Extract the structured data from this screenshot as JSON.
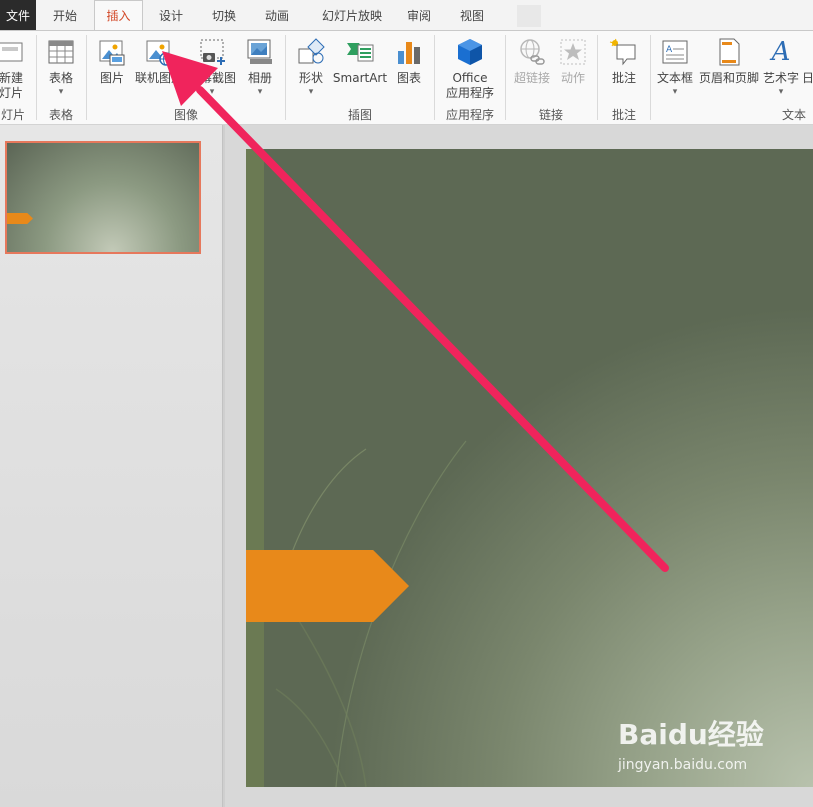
{
  "tabs": {
    "file": "文件",
    "home": "开始",
    "insert": "插入",
    "design": "设计",
    "transitions": "切换",
    "animations": "动画",
    "slideshow": "幻灯片放映",
    "review": "审阅",
    "view": "视图"
  },
  "ribbon": {
    "new_slide": {
      "line1": "新建",
      "line2": "灯片"
    },
    "table": "表格",
    "picture": "图片",
    "online_picture": "联机图片",
    "screenshot": "屏幕截图",
    "album": "相册",
    "shapes": "形状",
    "smartart": "SmartArt",
    "chart": "图表",
    "office_apps": {
      "line1": "Office",
      "line2": "应用程序"
    },
    "hyperlink": "超链接",
    "action": "动作",
    "comment": "批注",
    "textbox": "文本框",
    "header_footer": "页眉和页脚",
    "wordart": "艺术字",
    "more": "日"
  },
  "groups": {
    "slides": "灯片",
    "tables": "表格",
    "images": "图像",
    "illustrations": "插图",
    "apps": "应用程序",
    "links": "链接",
    "comments": "批注",
    "text": "文本"
  },
  "icons": {
    "caret": "▾",
    "wordart_glyph": "A"
  },
  "watermark": {
    "brand": "Baidu经验",
    "url": "jingyan.baidu.com"
  },
  "colors": {
    "accent": "#d24726",
    "arrow": "#f0245c",
    "slide_shape": "#e8891a"
  }
}
